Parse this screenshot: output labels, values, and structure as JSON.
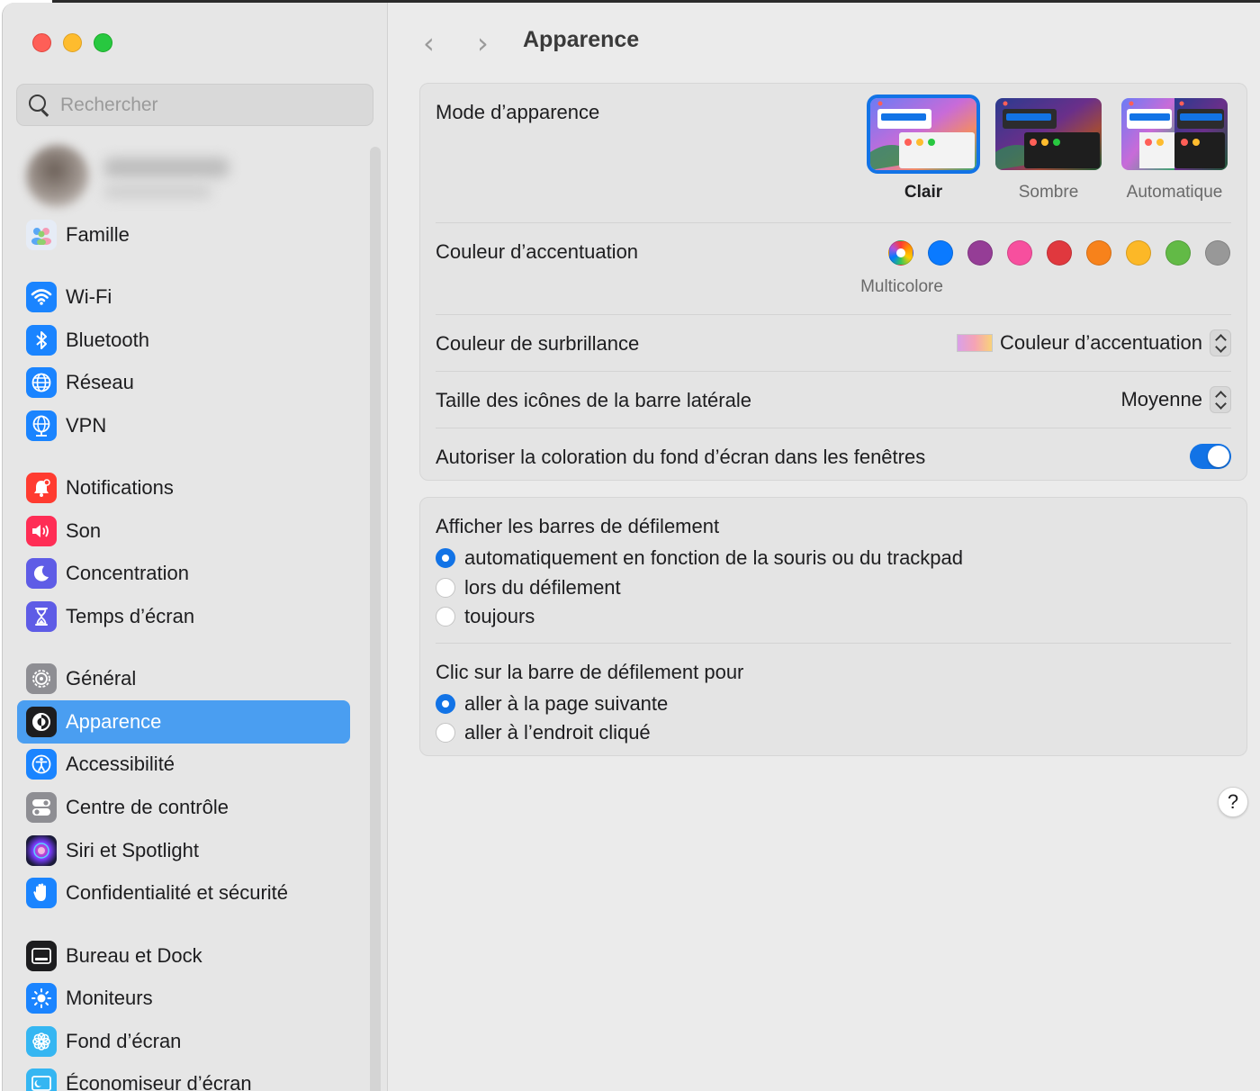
{
  "sidebar": {
    "search_placeholder": "Rechercher",
    "items": [
      {
        "label": "Famille",
        "icon": "family-icon",
        "color": "#e9eef7"
      },
      {
        "label": "Wi-Fi",
        "icon": "wifi-icon",
        "color": "#1a84ff"
      },
      {
        "label": "Bluetooth",
        "icon": "bluetooth-icon",
        "color": "#1a84ff"
      },
      {
        "label": "Réseau",
        "icon": "globe-icon",
        "color": "#1a84ff"
      },
      {
        "label": "VPN",
        "icon": "vpn-globe-icon",
        "color": "#1a84ff"
      },
      {
        "label": "Notifications",
        "icon": "bell-icon",
        "color": "#ff3b30"
      },
      {
        "label": "Son",
        "icon": "speaker-icon",
        "color": "#ff2d55"
      },
      {
        "label": "Concentration",
        "icon": "moon-icon",
        "color": "#5e5ce6"
      },
      {
        "label": "Temps d’écran",
        "icon": "hourglass-icon",
        "color": "#5e5ce6"
      },
      {
        "label": "Général",
        "icon": "gear-icon",
        "color": "#8e8e93"
      },
      {
        "label": "Apparence",
        "icon": "appearance-icon",
        "color": "#1d1d1f"
      },
      {
        "label": "Accessibilité",
        "icon": "accessibility-icon",
        "color": "#1a84ff"
      },
      {
        "label": "Centre de contrôle",
        "icon": "control-center-icon",
        "color": "#8e8e93"
      },
      {
        "label": "Siri et Spotlight",
        "icon": "siri-icon",
        "color": "#7a3cff"
      },
      {
        "label": "Confidentialité et sécurité",
        "icon": "hand-icon",
        "color": "#1a84ff"
      },
      {
        "label": "Bureau et Dock",
        "icon": "dock-icon",
        "color": "#1d1d1f"
      },
      {
        "label": "Moniteurs",
        "icon": "sun-icon",
        "color": "#1a84ff"
      },
      {
        "label": "Fond d’écran",
        "icon": "flower-icon",
        "color": "#35b6f2"
      },
      {
        "label": "Économiseur d’écran",
        "icon": "screensaver-icon",
        "color": "#35b6f2"
      }
    ],
    "active": "Apparence"
  },
  "header": {
    "title": "Apparence",
    "back_icon": "chevron-left-icon",
    "forward_icon": "chevron-right-icon"
  },
  "appearance": {
    "mode_label": "Mode d’apparence",
    "modes": [
      {
        "label": "Clair",
        "selected": true
      },
      {
        "label": "Sombre",
        "selected": false
      },
      {
        "label": "Automatique",
        "selected": false
      }
    ],
    "accent_label": "Couleur d’accentuation",
    "accent_selected_name": "Multicolore",
    "accent_colors": [
      "multicolor",
      "#0a7aff",
      "#953d96",
      "#f74f9e",
      "#e0383e",
      "#f7821b",
      "#fcb827",
      "#62ba46",
      "#989898"
    ],
    "highlight_label": "Couleur de surbrillance",
    "highlight_value": "Couleur d’accentuation",
    "sidebar_icon_label": "Taille des icônes de la barre latérale",
    "sidebar_icon_value": "Moyenne",
    "tinting_label": "Autoriser la coloration du fond d’écran dans les fenêtres",
    "tinting_on": true
  },
  "scrollbars": {
    "show_label": "Afficher les barres de défilement",
    "show_options": [
      {
        "label": "automatiquement en fonction de la souris ou du trackpad",
        "selected": true
      },
      {
        "label": "lors du défilement",
        "selected": false
      },
      {
        "label": "toujours",
        "selected": false
      }
    ],
    "click_label": "Clic sur la barre de défilement pour",
    "click_options": [
      {
        "label": "aller à la page suivante",
        "selected": true
      },
      {
        "label": "aller à l’endroit cliqué",
        "selected": false
      }
    ]
  },
  "help_label": "?"
}
